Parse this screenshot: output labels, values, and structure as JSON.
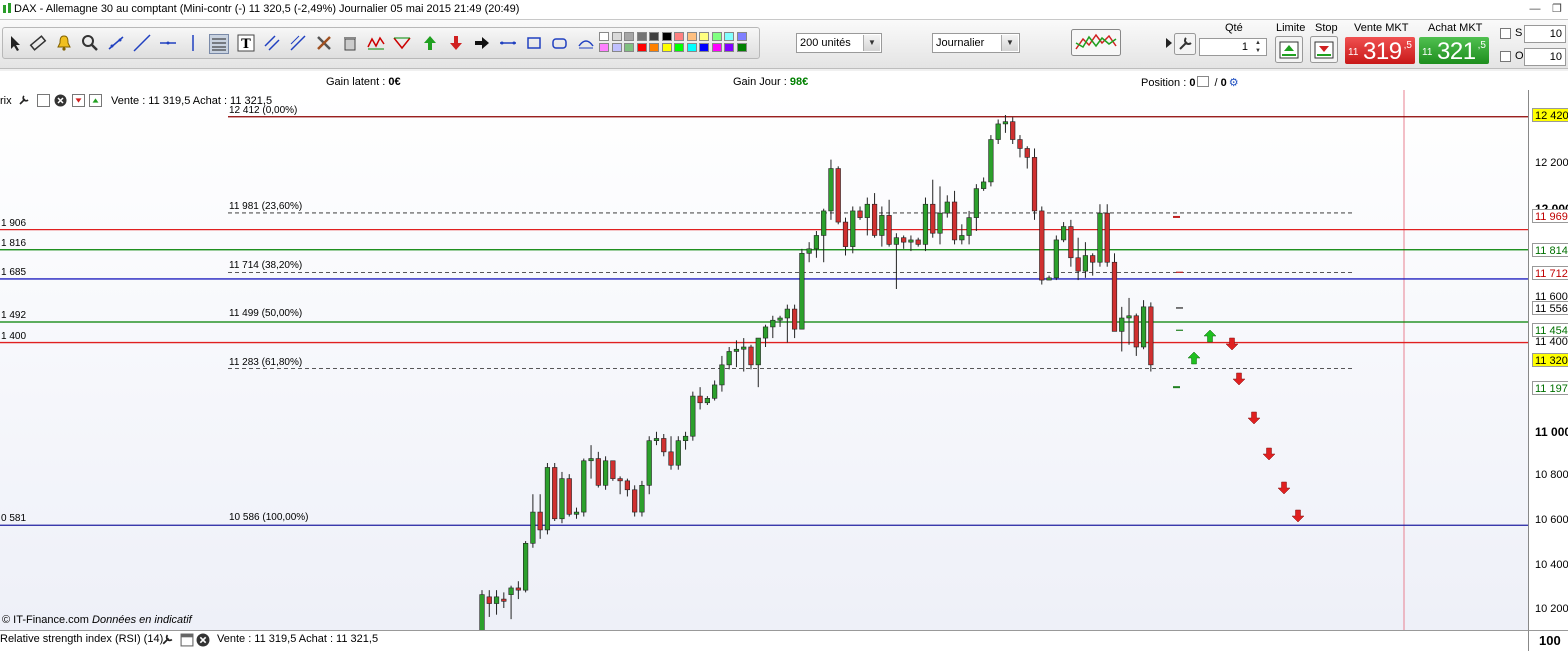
{
  "window": {
    "title": "DAX - Allemagne 30 au comptant (Mini-contr (-)   11 320,5 (-2,49%)   Journalier  05 mai 2015 21:49 (20:49)"
  },
  "toolbar": {
    "units_select": "200 unités",
    "period_select": "Journalier",
    "qty_label": "Qté",
    "qty_value": "1",
    "limit_label": "Limite",
    "stop_label": "Stop",
    "sell_label": "Vente MKT",
    "buy_label": "Achat MKT",
    "sell_price": {
      "small": "11",
      "big": "319",
      "sup": ",5"
    },
    "buy_price": {
      "small": "11",
      "big": "321",
      "sup": ",5"
    },
    "s_label": "S",
    "o_label": "O",
    "s_value": "10",
    "o_value": "10",
    "colors": [
      "#ffffff",
      "#d9d9d9",
      "#a6a6a6",
      "#737373",
      "#3f3f3f",
      "#000000",
      "#ff8080",
      "#ffc080",
      "#ffff80",
      "#80ff80",
      "#80ffff",
      "#8080ff",
      "#ff80ff",
      "#c0c0ff",
      "#80c080",
      "#ff0000",
      "#ff8000",
      "#ffff00",
      "#00ff00",
      "#00ffff",
      "#0000ff",
      "#ff00ff",
      "#8000ff",
      "#008000"
    ]
  },
  "infobar": {
    "gain_latent_label": "Gain latent : ",
    "gain_latent_value": "0€",
    "gain_jour_label": "Gain Jour : ",
    "gain_jour_value": "98€",
    "position_label": "Position : ",
    "position_value_1": "0",
    "position_sep": " / ",
    "position_value_2": "0"
  },
  "chart_header": {
    "prefix": "rix",
    "quote": "Vente : 11 319,5 Achat : 11 321,5"
  },
  "fib_levels": [
    {
      "label": "12 412 (0,00%)"
    },
    {
      "label": "11 981 (23,60%)"
    },
    {
      "label": "11 714 (38,20%)"
    },
    {
      "label": "11 499 (50,00%)"
    },
    {
      "label": "11 283 (61,80%)"
    },
    {
      "label": "10 586 (100,00%)"
    }
  ],
  "left_levels": [
    "1 906",
    "1 816",
    "1 685",
    "1 492",
    "1 400",
    "0 581"
  ],
  "axis_labels": [
    "12 200",
    "12 000",
    "11 600",
    "11 400",
    "11 000",
    "10 800",
    "10 600",
    "10 400",
    "10 200"
  ],
  "axis_tags": [
    {
      "text": "12 420",
      "bg": "#ffff00",
      "color": "#000000"
    },
    {
      "text": "11 969",
      "bg": "#ffffff",
      "color": "#c00000"
    },
    {
      "text": "11 814",
      "bg": "#ffffff",
      "color": "#007000"
    },
    {
      "text": "11 712",
      "bg": "#ffffff",
      "color": "#c00000"
    },
    {
      "text": "11 556",
      "bg": "#ffffff",
      "color": "#000000"
    },
    {
      "text": "11 454",
      "bg": "#ffffff",
      "color": "#007000"
    },
    {
      "text": "11 320",
      "bg": "#ffff00",
      "color": "#000000"
    },
    {
      "text": "11 197",
      "bg": "#ffffff",
      "color": "#007000"
    }
  ],
  "footer": {
    "source": "© IT-Finance.com",
    "note": "Données en indicatif"
  },
  "rsi": {
    "title": "Relative strength index (RSI) (14)",
    "quote": "Vente : 11 319,5 Achat : 11 321,5",
    "axis_value": "100"
  }
}
